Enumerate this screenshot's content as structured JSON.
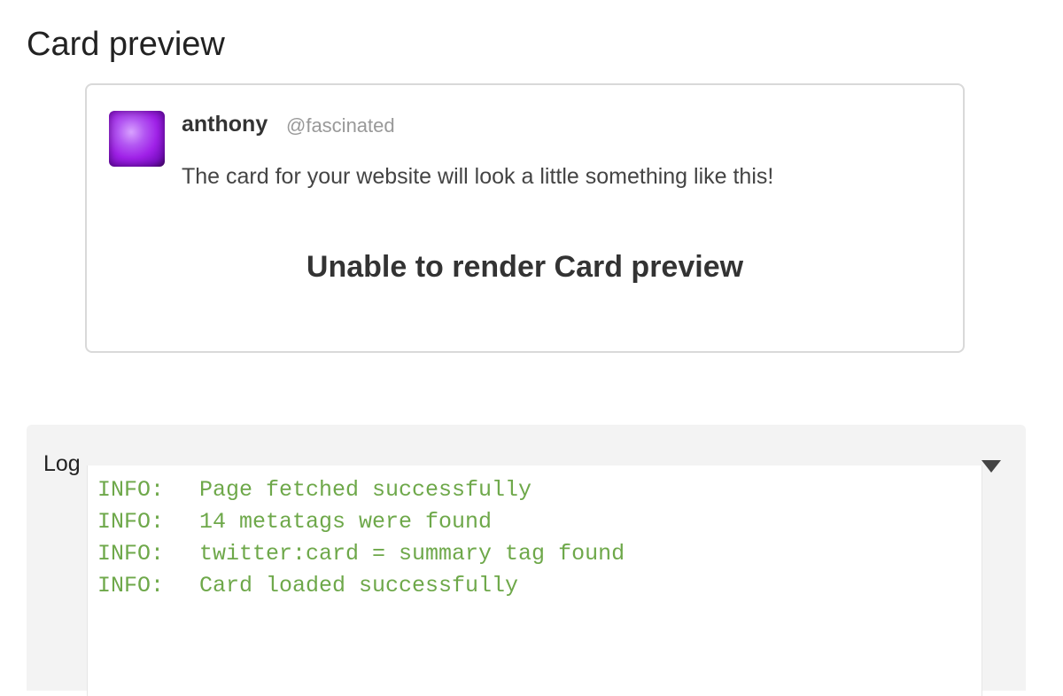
{
  "page": {
    "title": "Card preview"
  },
  "card": {
    "username": "anthony",
    "handle": "@fascinated",
    "text": "The card for your website will look a little something like this!",
    "error": "Unable to render Card preview"
  },
  "log": {
    "title": "Log",
    "toggle_icon": "triangle-down",
    "text_color": "#6ea84a",
    "entries": [
      {
        "level": "INFO:",
        "message": "Page fetched successfully"
      },
      {
        "level": "INFO:",
        "message": "14 metatags were found"
      },
      {
        "level": "INFO:",
        "message": "twitter:card = summary tag found"
      },
      {
        "level": "INFO:",
        "message": "Card loaded successfully"
      }
    ]
  }
}
